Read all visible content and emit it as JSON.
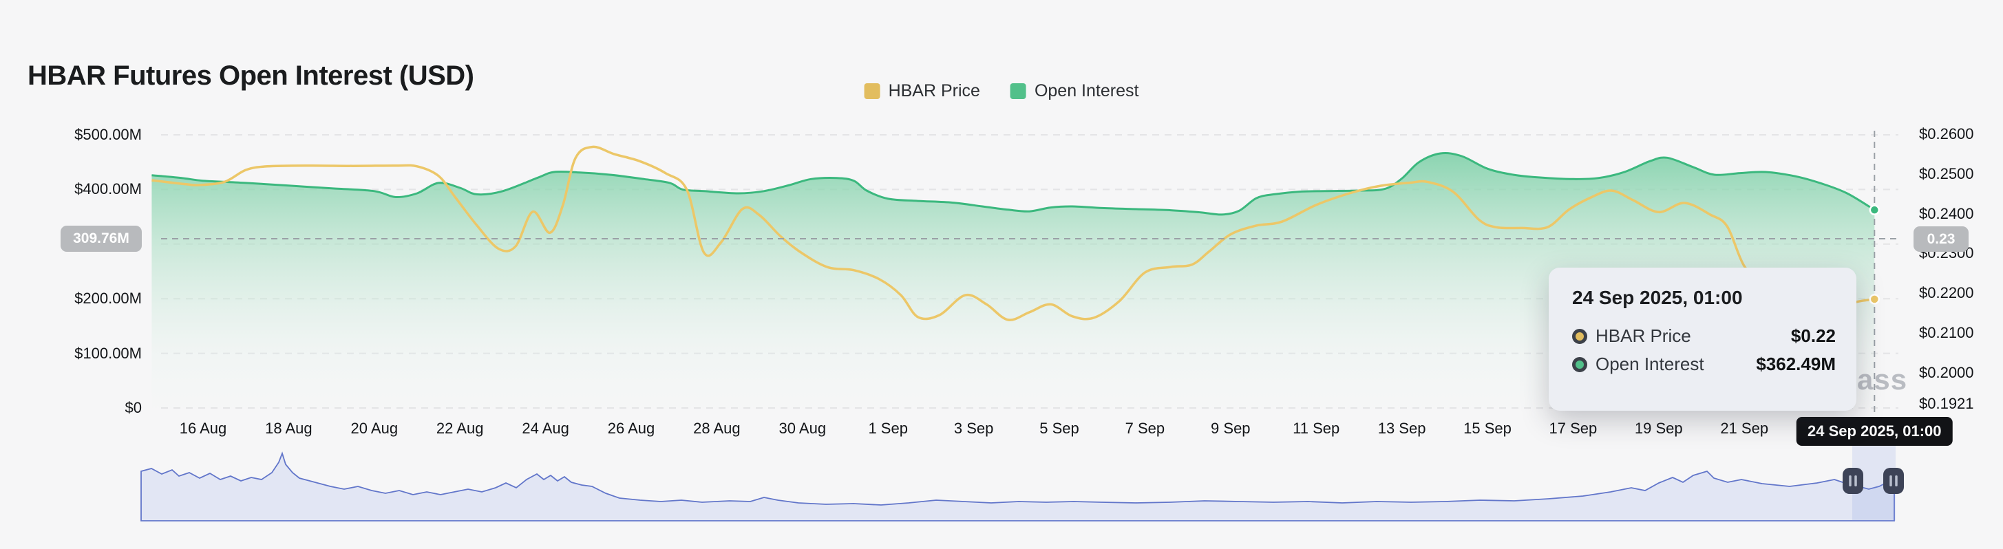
{
  "header": {
    "title": "HBAR Futures Open Interest (USD)"
  },
  "colors": {
    "background": "#f6f6f7",
    "price_line": "#ecc768",
    "oi_line": "#3bb87e",
    "oi_fill_top": "#74cda2",
    "legend_yellow": "#e2bd5f",
    "legend_green": "#52c08a",
    "gridline": "#e4e4e6",
    "crosshair": "#9aa0a6",
    "navigator_line": "#6276ca",
    "navigator_fill": "#e2e6f4",
    "selection_fill": "rgba(120,140,225,0.16)",
    "handle_bg": "#3d4357",
    "handle_grip": "#b9bfce"
  },
  "legend": [
    {
      "label": "HBAR Price",
      "color": "#e2bd5f"
    },
    {
      "label": "Open Interest",
      "color": "#52c08a"
    }
  ],
  "crosshair": {
    "t": 40.04,
    "x_pill": "24 Sep 2025, 01:00",
    "oi_value": 309.76,
    "oi_badge": "309.76M",
    "price_badge": "0.23"
  },
  "tooltip": {
    "title": "24 Sep 2025, 01:00",
    "rows": [
      {
        "label": "HBAR Price",
        "value": "$0.22",
        "color": "#e2bd5f"
      },
      {
        "label": "Open Interest",
        "value": "$362.49M",
        "color": "#52c08a"
      }
    ]
  },
  "watermark": "ass",
  "chart_data": {
    "type": "area",
    "title": "HBAR Futures Open Interest (USD)",
    "x_unit": "days since 2025-08-15 00:00",
    "x_range": [
      -0.2,
      40.04
    ],
    "legend_position": "top-center",
    "grid": true,
    "x_ticks": [
      {
        "t": 1,
        "label": "16 Aug"
      },
      {
        "t": 3,
        "label": "18 Aug"
      },
      {
        "t": 5,
        "label": "20 Aug"
      },
      {
        "t": 7,
        "label": "22 Aug"
      },
      {
        "t": 9,
        "label": "24 Aug"
      },
      {
        "t": 11,
        "label": "26 Aug"
      },
      {
        "t": 13,
        "label": "28 Aug"
      },
      {
        "t": 15,
        "label": "30 Aug"
      },
      {
        "t": 17,
        "label": "1 Sep"
      },
      {
        "t": 19,
        "label": "3 Sep"
      },
      {
        "t": 21,
        "label": "5 Sep"
      },
      {
        "t": 23,
        "label": "7 Sep"
      },
      {
        "t": 25,
        "label": "9 Sep"
      },
      {
        "t": 27,
        "label": "11 Sep"
      },
      {
        "t": 29,
        "label": "13 Sep"
      },
      {
        "t": 31,
        "label": "15 Sep"
      },
      {
        "t": 33,
        "label": "17 Sep"
      },
      {
        "t": 35,
        "label": "19 Sep"
      },
      {
        "t": 37,
        "label": "21 Sep"
      }
    ],
    "left_axis": {
      "ylim": [
        0,
        500
      ],
      "unit": "USD millions",
      "ticks": [
        {
          "v": 500,
          "label": "$500.00M"
        },
        {
          "v": 400,
          "label": "$400.00M"
        },
        {
          "v": 200,
          "label": "$200.00M"
        },
        {
          "v": 100,
          "label": "$100.00M"
        },
        {
          "v": 0,
          "label": "$0"
        }
      ],
      "gridline_values": [
        500,
        400,
        300,
        200,
        100,
        0
      ]
    },
    "right_axis": {
      "ylim": [
        0.1921,
        0.26
      ],
      "unit": "USD",
      "ticks": [
        {
          "v": 0.26,
          "label": "$0.2600"
        },
        {
          "v": 0.25,
          "label": "$0.2500"
        },
        {
          "v": 0.24,
          "label": "$0.2400"
        },
        {
          "v": 0.23,
          "label": "$0.2300"
        },
        {
          "v": 0.22,
          "label": "$0.2200"
        },
        {
          "v": 0.21,
          "label": "$0.2100"
        },
        {
          "v": 0.2,
          "label": "$0.2000"
        },
        {
          "v": 0.1921,
          "label": "$0.1921"
        }
      ]
    },
    "series": [
      {
        "name": "Open Interest",
        "type": "area",
        "axis": "left",
        "color": "#52c08a",
        "points": [
          [
            -0.2,
            426
          ],
          [
            0.5,
            421
          ],
          [
            1,
            416
          ],
          [
            2,
            412
          ],
          [
            3,
            407
          ],
          [
            4,
            402
          ],
          [
            5,
            397
          ],
          [
            5.5,
            386
          ],
          [
            6,
            393
          ],
          [
            6.5,
            412
          ],
          [
            7,
            403
          ],
          [
            7.4,
            391
          ],
          [
            8,
            397
          ],
          [
            8.8,
            421
          ],
          [
            9.2,
            432
          ],
          [
            9.8,
            431
          ],
          [
            10.5,
            427
          ],
          [
            11.3,
            419
          ],
          [
            11.9,
            412
          ],
          [
            12.2,
            400
          ],
          [
            12.7,
            397
          ],
          [
            13.5,
            393
          ],
          [
            14.1,
            397
          ],
          [
            14.7,
            408
          ],
          [
            15.2,
            419
          ],
          [
            15.8,
            421
          ],
          [
            16.2,
            416
          ],
          [
            16.5,
            398
          ],
          [
            17,
            383
          ],
          [
            17.7,
            379
          ],
          [
            18.5,
            376
          ],
          [
            19.2,
            369
          ],
          [
            19.8,
            363
          ],
          [
            20.3,
            360
          ],
          [
            20.8,
            367
          ],
          [
            21.3,
            369
          ],
          [
            22,
            366
          ],
          [
            22.8,
            364
          ],
          [
            23.6,
            362
          ],
          [
            24.3,
            358
          ],
          [
            24.8,
            354
          ],
          [
            25.2,
            361
          ],
          [
            25.6,
            384
          ],
          [
            26,
            391
          ],
          [
            26.6,
            396
          ],
          [
            27.2,
            397
          ],
          [
            28,
            398
          ],
          [
            28.6,
            401
          ],
          [
            29,
            420
          ],
          [
            29.4,
            450
          ],
          [
            29.9,
            466
          ],
          [
            30.4,
            461
          ],
          [
            31,
            438
          ],
          [
            31.6,
            427
          ],
          [
            32.2,
            422
          ],
          [
            33,
            419
          ],
          [
            33.6,
            421
          ],
          [
            34.2,
            432
          ],
          [
            34.8,
            452
          ],
          [
            35.2,
            458
          ],
          [
            35.8,
            441
          ],
          [
            36.3,
            427
          ],
          [
            36.9,
            430
          ],
          [
            37.5,
            432
          ],
          [
            38.2,
            424
          ],
          [
            38.8,
            411
          ],
          [
            39.4,
            393
          ],
          [
            40.04,
            362.49
          ]
        ]
      },
      {
        "name": "HBAR Price",
        "type": "line",
        "axis": "right",
        "color": "#ecc768",
        "points": [
          [
            -0.2,
            0.2484
          ],
          [
            0.6,
            0.2474
          ],
          [
            0.9,
            0.2472
          ],
          [
            1.5,
            0.248
          ],
          [
            2,
            0.251
          ],
          [
            2.5,
            0.2519
          ],
          [
            3.5,
            0.2521
          ],
          [
            4.5,
            0.252
          ],
          [
            5.5,
            0.2521
          ],
          [
            6,
            0.2519
          ],
          [
            6.5,
            0.2495
          ],
          [
            6.9,
            0.244
          ],
          [
            7.4,
            0.237
          ],
          [
            7.9,
            0.2312
          ],
          [
            8.3,
            0.2318
          ],
          [
            8.7,
            0.2405
          ],
          [
            9.1,
            0.2352
          ],
          [
            9.4,
            0.242
          ],
          [
            9.7,
            0.254
          ],
          [
            10.1,
            0.2568
          ],
          [
            10.6,
            0.255
          ],
          [
            11.2,
            0.2532
          ],
          [
            11.8,
            0.2502
          ],
          [
            12.3,
            0.246
          ],
          [
            12.7,
            0.2302
          ],
          [
            13.1,
            0.2328
          ],
          [
            13.6,
            0.2412
          ],
          [
            14,
            0.2396
          ],
          [
            14.5,
            0.2342
          ],
          [
            15,
            0.23
          ],
          [
            15.6,
            0.2265
          ],
          [
            16.2,
            0.2258
          ],
          [
            16.8,
            0.2235
          ],
          [
            17.3,
            0.2195
          ],
          [
            17.7,
            0.214
          ],
          [
            18.2,
            0.2145
          ],
          [
            18.8,
            0.2195
          ],
          [
            19.3,
            0.2172
          ],
          [
            19.8,
            0.2133
          ],
          [
            20.3,
            0.2152
          ],
          [
            20.8,
            0.2172
          ],
          [
            21.3,
            0.2142
          ],
          [
            21.8,
            0.2138
          ],
          [
            22.4,
            0.218
          ],
          [
            23,
            0.2252
          ],
          [
            23.6,
            0.2266
          ],
          [
            24.1,
            0.2272
          ],
          [
            24.5,
            0.2305
          ],
          [
            25,
            0.2348
          ],
          [
            25.6,
            0.237
          ],
          [
            26.2,
            0.238
          ],
          [
            27,
            0.2422
          ],
          [
            27.8,
            0.2452
          ],
          [
            28.5,
            0.247
          ],
          [
            29.2,
            0.2478
          ],
          [
            29.6,
            0.248
          ],
          [
            30.2,
            0.2455
          ],
          [
            30.8,
            0.2385
          ],
          [
            31.2,
            0.2366
          ],
          [
            31.8,
            0.2364
          ],
          [
            32.4,
            0.2366
          ],
          [
            32.9,
            0.241
          ],
          [
            33.4,
            0.244
          ],
          [
            33.9,
            0.2458
          ],
          [
            34.4,
            0.2434
          ],
          [
            35,
            0.2404
          ],
          [
            35.6,
            0.2427
          ],
          [
            36.2,
            0.2398
          ],
          [
            36.6,
            0.2368
          ],
          [
            37,
            0.2268
          ],
          [
            37.5,
            0.2218
          ],
          [
            38,
            0.2178
          ],
          [
            38.6,
            0.2156
          ],
          [
            39.2,
            0.2168
          ],
          [
            39.7,
            0.218
          ],
          [
            40.04,
            0.2185
          ]
        ]
      }
    ],
    "end_markers": [
      {
        "series": "Open Interest",
        "t": 40.04,
        "value": 362.49
      },
      {
        "series": "HBAR Price",
        "t": 40.04,
        "value": 0.2185
      }
    ]
  },
  "navigator": {
    "selection_x": [
      2691,
      2754
    ],
    "points": [
      [
        205,
        0.72
      ],
      [
        220,
        0.76
      ],
      [
        235,
        0.68
      ],
      [
        250,
        0.74
      ],
      [
        260,
        0.65
      ],
      [
        275,
        0.7
      ],
      [
        290,
        0.62
      ],
      [
        305,
        0.69
      ],
      [
        320,
        0.6
      ],
      [
        335,
        0.65
      ],
      [
        350,
        0.58
      ],
      [
        365,
        0.63
      ],
      [
        380,
        0.6
      ],
      [
        395,
        0.7
      ],
      [
        405,
        0.85
      ],
      [
        410,
        0.98
      ],
      [
        415,
        0.82
      ],
      [
        425,
        0.7
      ],
      [
        435,
        0.62
      ],
      [
        450,
        0.58
      ],
      [
        465,
        0.54
      ],
      [
        480,
        0.5
      ],
      [
        500,
        0.46
      ],
      [
        520,
        0.5
      ],
      [
        540,
        0.44
      ],
      [
        560,
        0.4
      ],
      [
        580,
        0.44
      ],
      [
        600,
        0.38
      ],
      [
        620,
        0.42
      ],
      [
        640,
        0.38
      ],
      [
        660,
        0.42
      ],
      [
        680,
        0.46
      ],
      [
        700,
        0.42
      ],
      [
        720,
        0.48
      ],
      [
        735,
        0.55
      ],
      [
        750,
        0.48
      ],
      [
        765,
        0.6
      ],
      [
        780,
        0.68
      ],
      [
        790,
        0.6
      ],
      [
        800,
        0.66
      ],
      [
        810,
        0.58
      ],
      [
        820,
        0.64
      ],
      [
        830,
        0.56
      ],
      [
        845,
        0.52
      ],
      [
        860,
        0.5
      ],
      [
        880,
        0.4
      ],
      [
        900,
        0.33
      ],
      [
        930,
        0.3
      ],
      [
        960,
        0.28
      ],
      [
        990,
        0.3
      ],
      [
        1020,
        0.27
      ],
      [
        1060,
        0.29
      ],
      [
        1090,
        0.28
      ],
      [
        1110,
        0.34
      ],
      [
        1130,
        0.3
      ],
      [
        1160,
        0.26
      ],
      [
        1200,
        0.24
      ],
      [
        1240,
        0.25
      ],
      [
        1280,
        0.23
      ],
      [
        1320,
        0.26
      ],
      [
        1360,
        0.3
      ],
      [
        1400,
        0.28
      ],
      [
        1440,
        0.26
      ],
      [
        1480,
        0.28
      ],
      [
        1520,
        0.27
      ],
      [
        1560,
        0.28
      ],
      [
        1600,
        0.27
      ],
      [
        1650,
        0.26
      ],
      [
        1700,
        0.27
      ],
      [
        1750,
        0.29
      ],
      [
        1800,
        0.28
      ],
      [
        1850,
        0.27
      ],
      [
        1900,
        0.28
      ],
      [
        1950,
        0.26
      ],
      [
        2000,
        0.28
      ],
      [
        2050,
        0.27
      ],
      [
        2100,
        0.28
      ],
      [
        2150,
        0.3
      ],
      [
        2200,
        0.29
      ],
      [
        2250,
        0.32
      ],
      [
        2300,
        0.36
      ],
      [
        2340,
        0.42
      ],
      [
        2370,
        0.48
      ],
      [
        2390,
        0.44
      ],
      [
        2410,
        0.55
      ],
      [
        2430,
        0.63
      ],
      [
        2445,
        0.56
      ],
      [
        2460,
        0.66
      ],
      [
        2480,
        0.72
      ],
      [
        2490,
        0.62
      ],
      [
        2510,
        0.56
      ],
      [
        2530,
        0.6
      ],
      [
        2560,
        0.54
      ],
      [
        2600,
        0.5
      ],
      [
        2640,
        0.55
      ],
      [
        2665,
        0.6
      ],
      [
        2680,
        0.55
      ],
      [
        2700,
        0.5
      ],
      [
        2715,
        0.46
      ],
      [
        2730,
        0.5
      ],
      [
        2740,
        0.55
      ],
      [
        2752,
        0.56
      ]
    ]
  }
}
